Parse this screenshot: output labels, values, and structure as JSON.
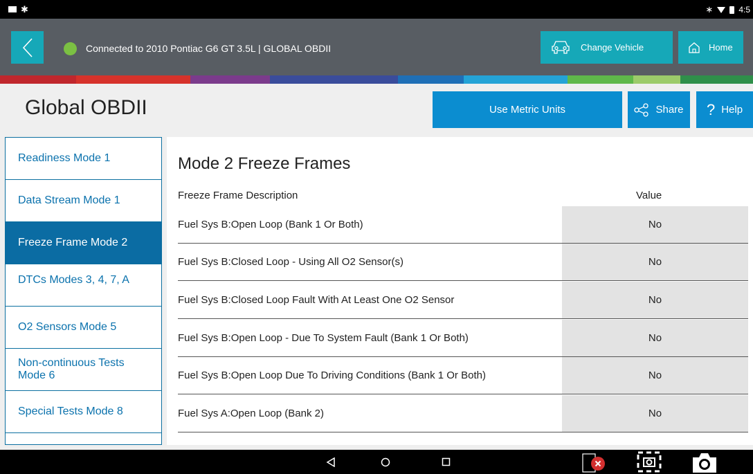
{
  "status_bar": {
    "time": "4:5",
    "icons": [
      "notification-box-icon",
      "settings-gear-icon",
      "bluetooth-icon",
      "wifi-icon",
      "battery-icon"
    ]
  },
  "header": {
    "back_icon": "chevron-left-icon",
    "connection_text": "Connected to 2010 Pontiac G6 GT 3.5L | GLOBAL OBDII",
    "connection_status_color": "#7bc043",
    "change_vehicle_label": "Change Vehicle",
    "home_label": "Home",
    "accent_color": "#16a8b8"
  },
  "color_strip": [
    "#c0272d",
    "#d6322b",
    "#7b3b8c",
    "#3a4c9b",
    "#1f6fb6",
    "#24a3d6",
    "#5fb84a",
    "#9ccb6a",
    "#2f8f4a"
  ],
  "title_bar": {
    "title": "Global OBDII",
    "metric_label": "Use Metric Units",
    "share_label": "Share",
    "help_label": "Help",
    "help_glyph": "?"
  },
  "sidebar": {
    "items": [
      {
        "label": "Readiness Mode 1",
        "active": false
      },
      {
        "label": "Data Stream Mode 1",
        "active": false
      },
      {
        "label": "Freeze Frame Mode 2",
        "active": true
      },
      {
        "label": "DTCs Modes 3, 4, 7, A",
        "active": false
      },
      {
        "label": "O2 Sensors Mode 5",
        "active": false
      },
      {
        "label": "Non-continuous Tests Mode 6",
        "active": false
      },
      {
        "label": "Special Tests Mode 8",
        "active": false
      }
    ]
  },
  "main": {
    "title": "Mode 2 Freeze Frames",
    "col_desc": "Freeze Frame Description",
    "col_value": "Value",
    "rows": [
      {
        "desc": "Fuel Sys B:Open Loop (Bank 1 Or Both)",
        "value": "No"
      },
      {
        "desc": "Fuel Sys B:Closed Loop - Using All O2 Sensor(s)",
        "value": "No"
      },
      {
        "desc": "Fuel Sys B:Closed Loop Fault With At Least One O2 Sensor",
        "value": "No"
      },
      {
        "desc": "Fuel Sys B:Open Loop - Due To System Fault (Bank 1 Or Both)",
        "value": "No"
      },
      {
        "desc": "Fuel Sys B:Open Loop Due To Driving Conditions (Bank 1 Or Both)",
        "value": "No"
      },
      {
        "desc": "Fuel Sys A:Open Loop (Bank 2)",
        "value": "No"
      }
    ]
  },
  "nav_bar": {
    "icons": [
      "back-triangle-icon",
      "home-circle-icon",
      "recents-square-icon",
      "close-record-icon",
      "screenshot-region-icon",
      "camera-icon"
    ]
  }
}
